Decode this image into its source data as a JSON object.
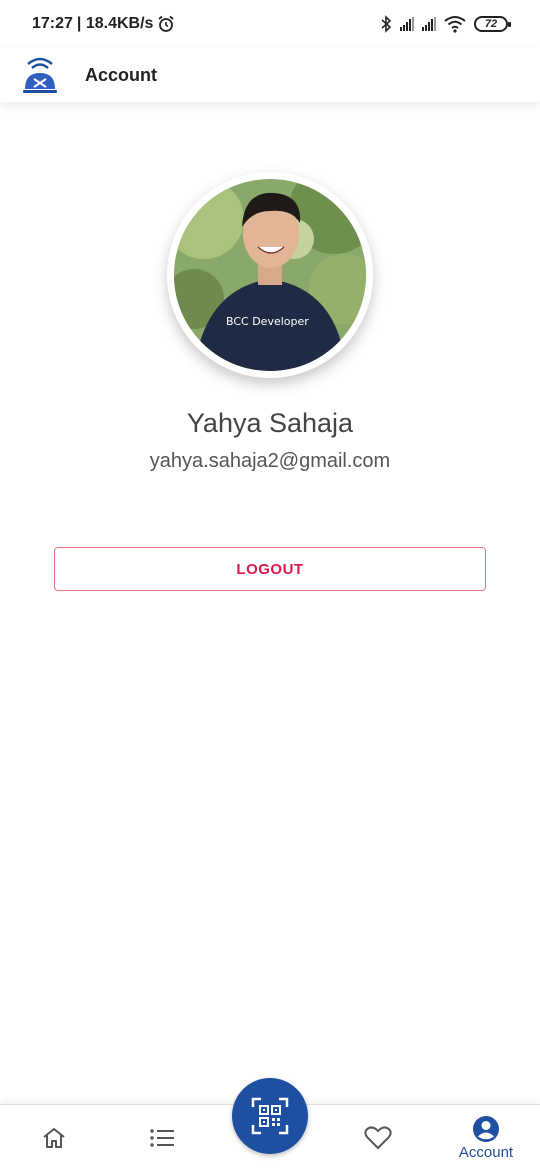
{
  "status_bar": {
    "time": "17:27",
    "network_speed": "| 18.4KB/s",
    "battery": "72"
  },
  "app_bar": {
    "title": "Account"
  },
  "profile": {
    "name": "Yahya Sahaja",
    "email": "yahya.sahaja2@gmail.com",
    "shirt_text": "BCC Developer"
  },
  "actions": {
    "logout_label": "LOGOUT"
  },
  "bottom_nav": {
    "items": [
      {
        "icon": "home-icon",
        "label": ""
      },
      {
        "icon": "list-icon",
        "label": ""
      },
      {
        "icon": "qr-scan-icon",
        "label": ""
      },
      {
        "icon": "heart-icon",
        "label": ""
      },
      {
        "icon": "account-icon",
        "label": "Account"
      }
    ]
  },
  "colors": {
    "primary": "#1e4fa0",
    "logout": "#d81b4a",
    "logout_border": "#e57387"
  }
}
